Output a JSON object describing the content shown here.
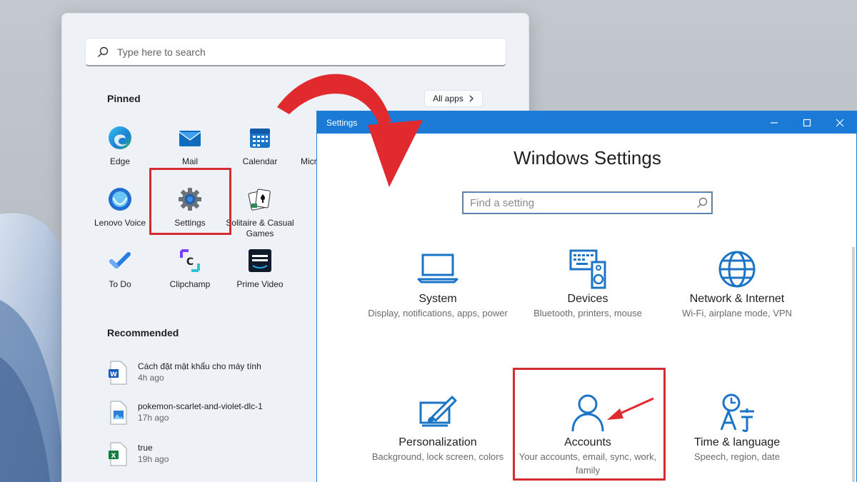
{
  "start_menu": {
    "search_placeholder": "Type here to search",
    "pinned_title": "Pinned",
    "all_apps_label": "All apps",
    "pinned_apps": [
      {
        "label": "Edge",
        "icon": "edge-icon"
      },
      {
        "label": "Mail",
        "icon": "mail-icon"
      },
      {
        "label": "Calendar",
        "icon": "calendar-icon"
      },
      {
        "label": "Micr",
        "icon": "microsoft-app-icon"
      },
      {
        "label": "Lenovo Voice",
        "icon": "lenovo-voice-icon"
      },
      {
        "label": "Settings",
        "icon": "gear-icon"
      },
      {
        "label": "Solitaire & Casual Games",
        "icon": "solitaire-icon"
      },
      {
        "label": "To Do",
        "icon": "todo-icon"
      },
      {
        "label": "Clipchamp",
        "icon": "clipchamp-icon"
      },
      {
        "label": "Prime Video",
        "icon": "prime-video-icon"
      }
    ],
    "recommended_title": "Recommended",
    "recommended": [
      {
        "name": "Cách đặt mật khẩu cho máy tính",
        "time": "4h ago",
        "icon": "word-file-icon"
      },
      {
        "name": "pokemon-scarlet-and-violet-dlc-1",
        "time": "17h ago",
        "icon": "image-file-icon"
      },
      {
        "name": "true",
        "time": "19h ago",
        "icon": "excel-file-icon"
      }
    ]
  },
  "settings_window": {
    "title": "Settings",
    "heading": "Windows Settings",
    "search_placeholder": "Find a setting",
    "categories": [
      {
        "title": "System",
        "desc": "Display, notifications, apps, power",
        "icon": "laptop-icon"
      },
      {
        "title": "Devices",
        "desc": "Bluetooth, printers, mouse",
        "icon": "devices-icon"
      },
      {
        "title": "Network & Internet",
        "desc": "Wi-Fi, airplane mode, VPN",
        "icon": "globe-icon"
      },
      {
        "title": "Personalization",
        "desc": "Background, lock screen, colors",
        "icon": "personalization-icon"
      },
      {
        "title": "Accounts",
        "desc": "Your accounts, email, sync, work, family",
        "icon": "person-icon"
      },
      {
        "title": "Time & language",
        "desc": "Speech, region, date",
        "icon": "time-language-icon"
      }
    ]
  },
  "colors": {
    "accent_blue": "#1a7ad6",
    "highlight_red": "#d52b32",
    "icon_blue": "#1b74c6"
  }
}
